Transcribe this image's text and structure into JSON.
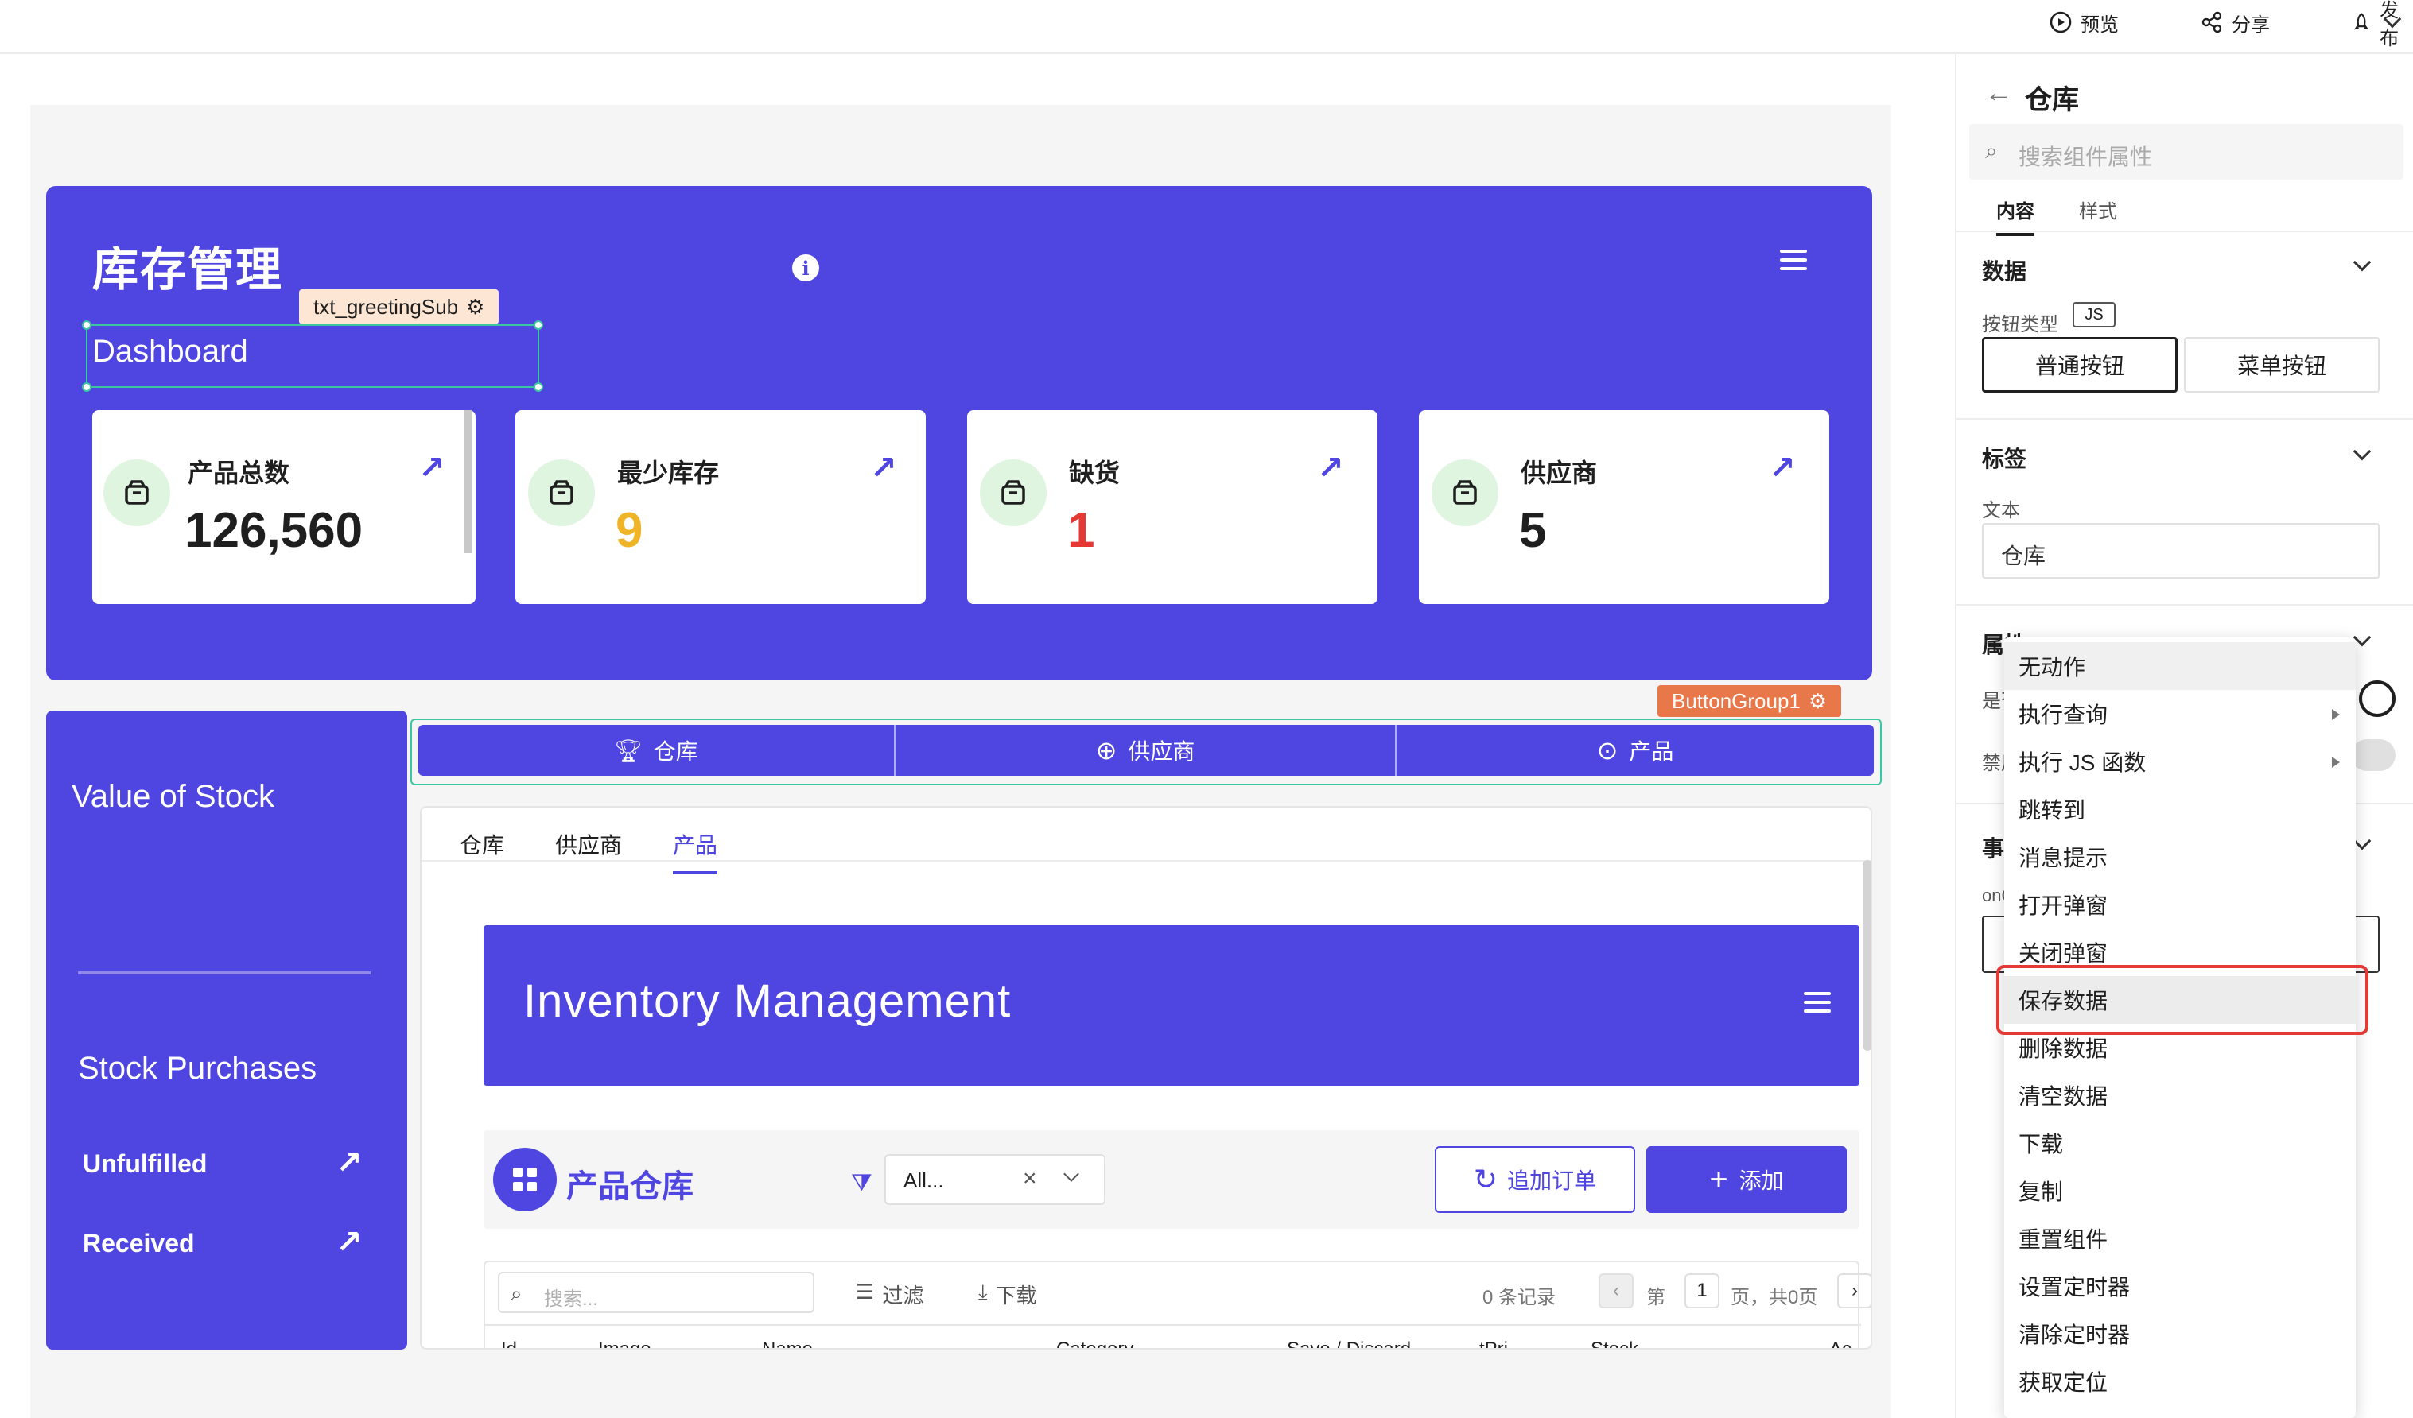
{
  "topbar": {
    "preview": "预览",
    "share": "分享",
    "publish": "发布"
  },
  "hero": {
    "title": "库存管理",
    "info_glyph": "i",
    "selected_tag": "txt_greetingSub",
    "subtitle": "Dashboard"
  },
  "stats": [
    {
      "label": "产品总数",
      "value": "126,560",
      "value_color": "#1f1f1f"
    },
    {
      "label": "最少库存",
      "value": "9",
      "value_color": "#f0b429"
    },
    {
      "label": "缺货",
      "value": "1",
      "value_color": "#e53935"
    },
    {
      "label": "供应商",
      "value": "5",
      "value_color": "#1f1f1f"
    }
  ],
  "left_panel": {
    "value_of_stock": "Value of Stock",
    "stock_purchases": "Stock Purchases",
    "unfulfilled": "Unfulfilled",
    "received": "Received"
  },
  "button_group": {
    "tag": "ButtonGroup1",
    "buttons": [
      "仓库",
      "供应商",
      "产品"
    ]
  },
  "content": {
    "tabs": [
      "仓库",
      "供应商",
      "产品"
    ],
    "active_tab": "产品",
    "inv_title": "Inventory Management",
    "section_title": "产品仓库",
    "filter_value": "All...",
    "append_order": "追加订单",
    "add": "添加",
    "search_placeholder": "搜索...",
    "filter": "过滤",
    "download": "下载",
    "records": "0 条记录",
    "page_prefix": "第",
    "page_num": "1",
    "page_suffix": "页，共0页",
    "columns": [
      "Id",
      "Image",
      "Name",
      "Category",
      "Save / Discard",
      "tPri",
      "Stock",
      "Ac"
    ]
  },
  "right_panel": {
    "title": "仓库",
    "search_placeholder": "搜索组件属性",
    "tabs": [
      "内容",
      "样式"
    ],
    "data_section": "数据",
    "button_type_label": "按钮类型",
    "js_badge": "JS",
    "btn_normal": "普通按钮",
    "btn_menu": "菜单按钮",
    "label_section": "标签",
    "text_label": "文本",
    "text_value": "仓库",
    "attr_section": "属性",
    "attr_row1": "是否",
    "attr_row2": "禁用",
    "event_section": "事件",
    "event_label": "onC"
  },
  "action_menu": {
    "items": [
      "无动作",
      "执行查询",
      "执行 JS 函数",
      "跳转到",
      "消息提示",
      "打开弹窗",
      "关闭弹窗",
      "保存数据",
      "删除数据",
      "清空数据",
      "下载",
      "复制",
      "重置组件",
      "设置定时器",
      "清除定时器",
      "获取定位"
    ],
    "highlighted": "保存数据"
  },
  "colors": {
    "primary": "#4f45e0",
    "selection": "#3bc8a0",
    "tag_orange": "#e8784a",
    "tag_peach": "#fde6d3",
    "highlight_red": "#e53935"
  }
}
